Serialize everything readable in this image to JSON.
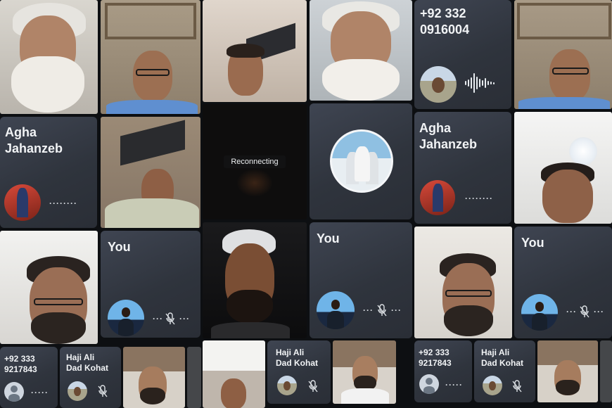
{
  "status": {
    "reconnecting_label": "Reconnecting"
  },
  "participants": {
    "agha_1": {
      "name": "Agha\nJahanzeb"
    },
    "agha_2": {
      "name": "Agha\nJahanzeb"
    },
    "you_1": {
      "name": "You",
      "more": "···",
      "overflow": "···"
    },
    "you_2": {
      "name": "You",
      "more": "···",
      "overflow": "···"
    },
    "you_3": {
      "name": "You",
      "more": "···",
      "overflow": "···"
    },
    "phone_top": {
      "name": "+92 332\n0916004"
    },
    "phone_bl_1": {
      "name": "+92 333\n9217843"
    },
    "phone_bl_2": {
      "name": "+92 333\n9217843"
    },
    "haji_1": {
      "name": "Haji Ali\nDad Kohat"
    },
    "haji_2": {
      "name": "Haji Ali\nDad Kohat"
    },
    "haji_3": {
      "name": "Haji Ali\nDad Kohat"
    }
  },
  "icons": {
    "mic_off": "mic-off-icon",
    "speaking": "audio-wave-icon",
    "avatar": "avatar"
  },
  "colors": {
    "card_bg": "#333844",
    "page_bg": "#0d0f12",
    "text": "#f1f3f5"
  }
}
